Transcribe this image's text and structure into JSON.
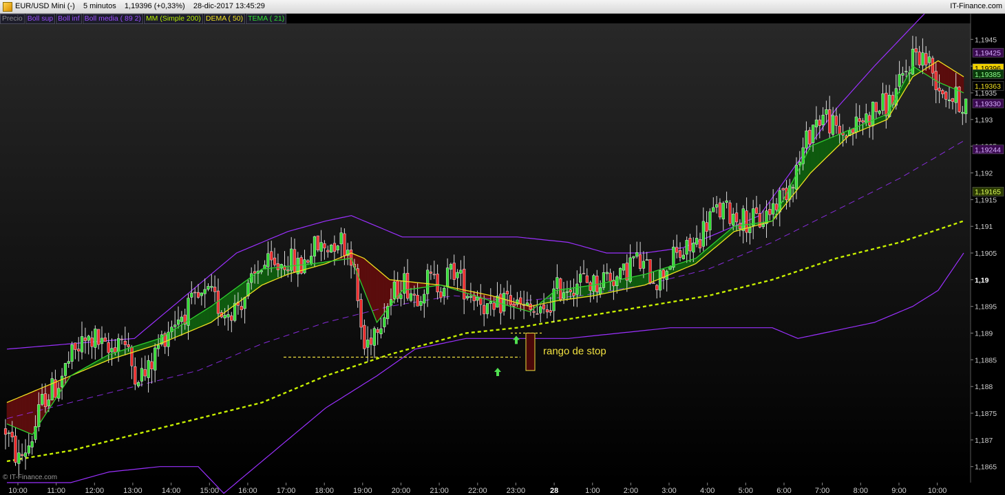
{
  "window": {
    "title": "EUR/USD Mini (-)    5 minutos    1,19396 (+0,33%)    28-dic-2017 13:45:29",
    "brand": "IT-Finance.com"
  },
  "legend": [
    {
      "label": "Precio",
      "color": "#8a8a8a"
    },
    {
      "label": "Boll sup",
      "color": "#9b4dff"
    },
    {
      "label": "Boll inf",
      "color": "#9b4dff"
    },
    {
      "label": "Boll media ( 89 2)",
      "color": "#9b4dff"
    },
    {
      "label": "MM (Simple 200)",
      "color": "#b8f000"
    },
    {
      "label": "DEMA ( 50)",
      "color": "#f0e020"
    },
    {
      "label": "TEMA ( 21)",
      "color": "#30e030"
    }
  ],
  "colors": {
    "background_top": "#262626",
    "background_bottom": "#000000",
    "bull": "#33dd33",
    "bear": "#ee2a2a",
    "bollinger": "#9b30ff",
    "sma": "#c8f000",
    "dema": "#f0e020",
    "tema": "#2fcf2f",
    "fill_up": "#0f5a0f",
    "fill_down": "#5a0d0d",
    "annotation": "#f0e040",
    "arrow": "#50e050"
  },
  "watermark": "© IT-Finance.com",
  "annotation": {
    "text": "rango de stop",
    "top": 1.189,
    "bottom": 1.1883,
    "support": 1.18855
  },
  "chart_data": {
    "type": "candlestick",
    "instrument": "EUR/USD Mini (-)",
    "timeframe": "5 minutos",
    "last": 1.19396,
    "change": "+0,33%",
    "x_labels": [
      "10:00",
      "11:00",
      "12:00",
      "13:00",
      "14:00",
      "15:00",
      "16:00",
      "17:00",
      "18:00",
      "19:00",
      "20:00",
      "21:00",
      "22:00",
      "23:00",
      "28",
      "1:00",
      "2:00",
      "3:00",
      "4:00",
      "5:00",
      "6:00",
      "7:00",
      "8:00",
      "9:00",
      "10:00"
    ],
    "y_ticks": [
      "1,1865",
      "1,187",
      "1,1875",
      "1,188",
      "1,1885",
      "1,189",
      "1,1895",
      "1,19",
      "1,1905",
      "1,191",
      "1,1915",
      "1,192",
      "1,1925",
      "1,193",
      "1,1935",
      "1,194",
      "1,1945"
    ],
    "ylim": [
      1.1862,
      1.1948
    ],
    "price_path": [
      [
        0,
        1.1872
      ],
      [
        1,
        1.1866
      ],
      [
        2,
        1.187
      ],
      [
        3,
        1.1878
      ],
      [
        4,
        1.188
      ],
      [
        5,
        1.1885
      ],
      [
        6,
        1.1888
      ],
      [
        7,
        1.1889
      ],
      [
        8,
        1.1886
      ],
      [
        9,
        1.189
      ],
      [
        10,
        1.1883
      ],
      [
        11,
        1.1882
      ],
      [
        12,
        1.1888
      ],
      [
        13,
        1.1892
      ],
      [
        14,
        1.1894
      ],
      [
        15,
        1.1896
      ],
      [
        16,
        1.1897
      ],
      [
        17,
        1.1894
      ],
      [
        18,
        1.1895
      ],
      [
        19,
        1.1898
      ],
      [
        20,
        1.1903
      ],
      [
        21,
        1.1902
      ],
      [
        22,
        1.1904
      ],
      [
        23,
        1.1902
      ],
      [
        24,
        1.1906
      ],
      [
        25,
        1.1906
      ],
      [
        26,
        1.1908
      ],
      [
        27,
        1.1905
      ],
      [
        28,
        1.1887
      ],
      [
        29,
        1.1892
      ],
      [
        30,
        1.1896
      ],
      [
        31,
        1.19
      ],
      [
        32,
        1.1897
      ],
      [
        33,
        1.19
      ],
      [
        34,
        1.1899
      ],
      [
        35,
        1.1902
      ],
      [
        36,
        1.1898
      ],
      [
        37,
        1.1897
      ],
      [
        38,
        1.1893
      ],
      [
        39,
        1.1897
      ],
      [
        40,
        1.1895
      ],
      [
        41,
        1.1894
      ],
      [
        42,
        1.1893
      ],
      [
        43,
        1.1898
      ],
      [
        44,
        1.1899
      ],
      [
        45,
        1.19
      ],
      [
        46,
        1.1899
      ],
      [
        47,
        1.1901
      ],
      [
        48,
        1.19
      ],
      [
        49,
        1.1904
      ],
      [
        50,
        1.1902
      ],
      [
        51,
        1.19
      ],
      [
        52,
        1.1904
      ],
      [
        53,
        1.1905
      ],
      [
        54,
        1.1907
      ],
      [
        55,
        1.1912
      ],
      [
        56,
        1.1913
      ],
      [
        57,
        1.1912
      ],
      [
        58,
        1.1911
      ],
      [
        59,
        1.1911
      ],
      [
        60,
        1.1914
      ],
      [
        61,
        1.1917
      ],
      [
        62,
        1.1922
      ],
      [
        63,
        1.1929
      ],
      [
        64,
        1.1931
      ],
      [
        65,
        1.1927
      ],
      [
        66,
        1.1928
      ],
      [
        67,
        1.193
      ],
      [
        68,
        1.1932
      ],
      [
        69,
        1.1933
      ],
      [
        70,
        1.1937
      ],
      [
        71,
        1.1943
      ],
      [
        72,
        1.1941
      ],
      [
        73,
        1.1936
      ],
      [
        74,
        1.1934
      ],
      [
        75,
        1.1933
      ]
    ],
    "series": [
      {
        "name": "Boll sup",
        "path": [
          [
            0,
            1.1887
          ],
          [
            5,
            1.1888
          ],
          [
            10,
            1.1889
          ],
          [
            14,
            1.1897
          ],
          [
            18,
            1.1905
          ],
          [
            22,
            1.1909
          ],
          [
            25,
            1.1911
          ],
          [
            27,
            1.1912
          ],
          [
            29,
            1.191
          ],
          [
            31,
            1.1908
          ],
          [
            35,
            1.1908
          ],
          [
            40,
            1.1908
          ],
          [
            44,
            1.1907
          ],
          [
            47,
            1.1905
          ],
          [
            50,
            1.1905
          ],
          [
            53,
            1.1906
          ],
          [
            56,
            1.1909
          ],
          [
            59,
            1.1912
          ],
          [
            62,
            1.1922
          ],
          [
            65,
            1.1932
          ],
          [
            68,
            1.194
          ],
          [
            70,
            1.1945
          ],
          [
            72,
            1.195
          ],
          [
            75,
            1.1952
          ]
        ]
      },
      {
        "name": "Boll inf",
        "path": [
          [
            0,
            1.1862
          ],
          [
            5,
            1.1862
          ],
          [
            8,
            1.1864
          ],
          [
            12,
            1.1865
          ],
          [
            15,
            1.1865
          ],
          [
            17,
            1.186
          ],
          [
            21,
            1.1868
          ],
          [
            25,
            1.1876
          ],
          [
            29,
            1.1882
          ],
          [
            32,
            1.1887
          ],
          [
            36,
            1.1889
          ],
          [
            40,
            1.1889
          ],
          [
            44,
            1.1889
          ],
          [
            48,
            1.189
          ],
          [
            52,
            1.1891
          ],
          [
            56,
            1.1891
          ],
          [
            60,
            1.1891
          ],
          [
            62,
            1.1889
          ],
          [
            64,
            1.189
          ],
          [
            68,
            1.1892
          ],
          [
            71,
            1.1895
          ],
          [
            73,
            1.1898
          ],
          [
            75,
            1.1905
          ]
        ]
      },
      {
        "name": "Boll media ( 89 2)",
        "path": [
          [
            0,
            1.1874
          ],
          [
            5,
            1.1877
          ],
          [
            10,
            1.188
          ],
          [
            15,
            1.1883
          ],
          [
            20,
            1.1888
          ],
          [
            25,
            1.1892
          ],
          [
            30,
            1.1895
          ],
          [
            35,
            1.1897
          ],
          [
            40,
            1.1896
          ],
          [
            45,
            1.1897
          ],
          [
            50,
            1.1899
          ],
          [
            55,
            1.1902
          ],
          [
            60,
            1.1907
          ],
          [
            65,
            1.1913
          ],
          [
            70,
            1.1919
          ],
          [
            75,
            1.1926
          ]
        ]
      },
      {
        "name": "MM (Simple 200)",
        "path": [
          [
            0,
            1.1866
          ],
          [
            5,
            1.1868
          ],
          [
            10,
            1.1871
          ],
          [
            15,
            1.1874
          ],
          [
            20,
            1.1877
          ],
          [
            25,
            1.1882
          ],
          [
            30,
            1.1886
          ],
          [
            33,
            1.1888
          ],
          [
            36,
            1.189
          ],
          [
            40,
            1.1891
          ],
          [
            45,
            1.1893
          ],
          [
            50,
            1.1895
          ],
          [
            55,
            1.1897
          ],
          [
            60,
            1.19
          ],
          [
            65,
            1.1904
          ],
          [
            70,
            1.1907
          ],
          [
            75,
            1.1911
          ]
        ]
      },
      {
        "name": "DEMA ( 50)",
        "path": [
          [
            0,
            1.1877
          ],
          [
            4,
            1.1881
          ],
          [
            8,
            1.1885
          ],
          [
            12,
            1.1888
          ],
          [
            16,
            1.1892
          ],
          [
            20,
            1.1899
          ],
          [
            22,
            1.1901
          ],
          [
            25,
            1.1903
          ],
          [
            27,
            1.1905
          ],
          [
            28,
            1.1904
          ],
          [
            30,
            1.19
          ],
          [
            34,
            1.1899
          ],
          [
            38,
            1.1897
          ],
          [
            41,
            1.1895
          ],
          [
            43,
            1.1896
          ],
          [
            46,
            1.1897
          ],
          [
            50,
            1.1899
          ],
          [
            54,
            1.1903
          ],
          [
            57,
            1.1909
          ],
          [
            60,
            1.1911
          ],
          [
            63,
            1.192
          ],
          [
            66,
            1.1927
          ],
          [
            69,
            1.193
          ],
          [
            71,
            1.1938
          ],
          [
            73,
            1.1941
          ],
          [
            75,
            1.1938
          ]
        ]
      },
      {
        "name": "TEMA ( 21)",
        "path": [
          [
            0,
            1.1873
          ],
          [
            2,
            1.1871
          ],
          [
            5,
            1.1882
          ],
          [
            8,
            1.1886
          ],
          [
            12,
            1.1889
          ],
          [
            16,
            1.1895
          ],
          [
            20,
            1.1902
          ],
          [
            24,
            1.1903
          ],
          [
            27,
            1.1904
          ],
          [
            29,
            1.1892
          ],
          [
            31,
            1.1898
          ],
          [
            34,
            1.1899
          ],
          [
            38,
            1.1896
          ],
          [
            41,
            1.1894
          ],
          [
            43,
            1.1898
          ],
          [
            46,
            1.1899
          ],
          [
            50,
            1.1901
          ],
          [
            54,
            1.1904
          ],
          [
            57,
            1.191
          ],
          [
            60,
            1.1911
          ],
          [
            63,
            1.1925
          ],
          [
            66,
            1.1928
          ],
          [
            69,
            1.1931
          ],
          [
            71,
            1.194
          ],
          [
            73,
            1.1937
          ],
          [
            75,
            1.1935
          ]
        ]
      }
    ],
    "price_tags": [
      {
        "value": "1,19425",
        "bg": "#3a0a50",
        "fg": "#d8b0ff"
      },
      {
        "value": "1,19396",
        "bg": "#f0d000",
        "fg": "#000000"
      },
      {
        "value": "1,19385",
        "bg": "#0a3a0a",
        "fg": "#90ff90"
      },
      {
        "value": "1,19363",
        "bg": "#000000",
        "fg": "#f0e020"
      },
      {
        "value": "1,19330",
        "bg": "#3a0a50",
        "fg": "#d8b0ff"
      },
      {
        "value": "1,19244",
        "bg": "#3a0a50",
        "fg": "#d8b0ff"
      },
      {
        "value": "1,19165",
        "bg": "#2a3a00",
        "fg": "#e0ff60"
      }
    ]
  }
}
